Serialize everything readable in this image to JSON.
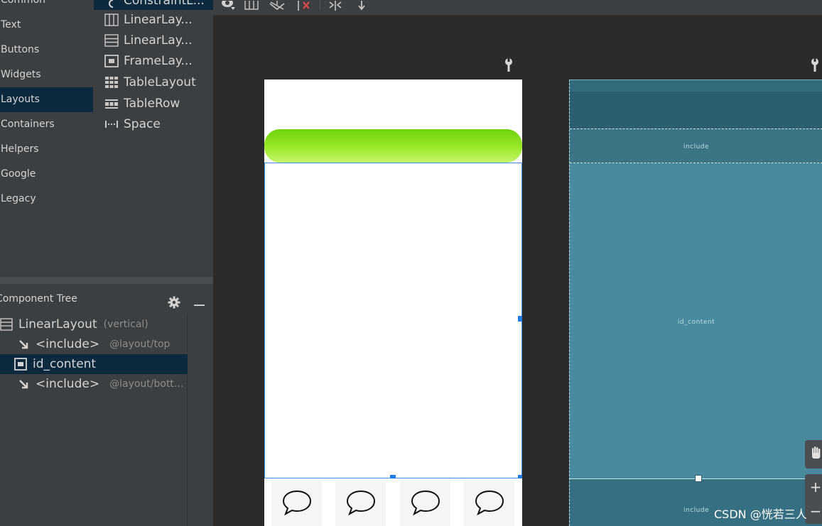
{
  "palette": {
    "categories": [
      "Common",
      "Text",
      "Buttons",
      "Widgets",
      "Layouts",
      "Containers",
      "Helpers",
      "Google",
      "Legacy"
    ],
    "selected_category": "Layouts",
    "items": [
      {
        "label": "ConstraintL...",
        "icon": "constraint-layout-icon"
      },
      {
        "label": "LinearLay...",
        "icon": "linear-layout-horizontal-icon"
      },
      {
        "label": "LinearLay...",
        "icon": "linear-layout-vertical-icon"
      },
      {
        "label": "FrameLay...",
        "icon": "frame-layout-icon"
      },
      {
        "label": "TableLayout",
        "icon": "table-layout-icon"
      },
      {
        "label": "TableRow",
        "icon": "table-row-icon"
      },
      {
        "label": "Space",
        "icon": "space-icon"
      }
    ]
  },
  "component_tree": {
    "title": "Component Tree",
    "nodes": [
      {
        "label": "LinearLayout",
        "hint": "(vertical)",
        "icon": "linear-layout-icon"
      },
      {
        "label": "<include>",
        "hint": "@layout/top",
        "icon": "include-arrow-icon"
      },
      {
        "label": "id_content",
        "hint": "",
        "icon": "frame-layout-icon"
      },
      {
        "label": "<include>",
        "hint": "@layout/bott...",
        "icon": "include-arrow-icon"
      }
    ],
    "selected_node": "id_content"
  },
  "blueprint": {
    "labels": {
      "include_top": "include",
      "content": "id_content",
      "include_bottom": "include"
    }
  },
  "zoom_controls": {
    "zoom_in": "+",
    "zoom_out": "−"
  },
  "watermark": "CSDN @恍若三人",
  "colors": {
    "panel_bg": "#3c3f41",
    "selection_bg": "#0d293e",
    "canvas_bg": "#2b2b2b",
    "blueprint_bg": "#4a8a9e",
    "selection_border": "#3a8ee6",
    "green_bar": "#7fdc1a"
  }
}
